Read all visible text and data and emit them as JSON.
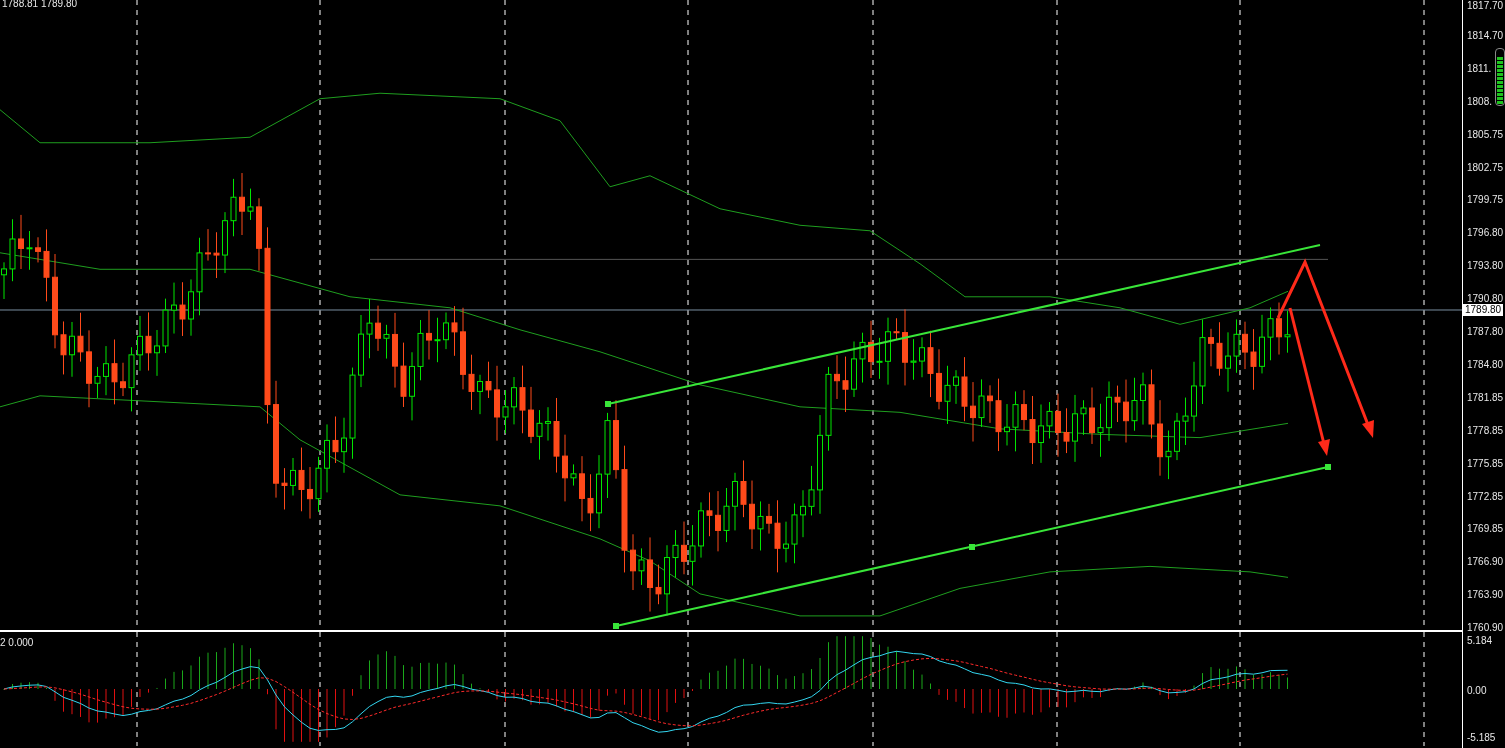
{
  "quote_header": "1788.81 1789.80",
  "price_axis": {
    "ticks": [
      "1817.70",
      "1814.70",
      "1811.",
      "1808.",
      "1805.75",
      "1802.75",
      "1799.75",
      "1796.80",
      "1793.80",
      "1790.80",
      "1787.80",
      "1784.80",
      "1781.85",
      "1778.85",
      "1775.85",
      "1772.85",
      "1769.85",
      "1766.90",
      "1763.90",
      "1760.90"
    ],
    "current_price": "1789.80"
  },
  "indicator_panel": {
    "label": "2 0.000",
    "axis_ticks": [
      "5.184",
      "0.00",
      "-5.185"
    ]
  }
}
